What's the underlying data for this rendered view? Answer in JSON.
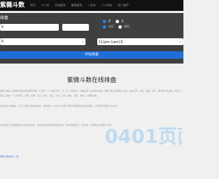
{
  "header": {
    "brand": "紫薇斗数",
    "nav": [
      "首页",
      "十二宫",
      "天府星系",
      "紫薇星系",
      "八卦系",
      "六十四卦",
      "奇门遁甲"
    ]
  },
  "form": {
    "title": "排盘",
    "birth_value": "0",
    "gender_options": [
      "男",
      "女"
    ],
    "calendar_options": [
      "公历",
      "农历"
    ],
    "select_left_value": "0",
    "select_right_value": "11(pm-1am)子",
    "submit_label": "开始排盘"
  },
  "content": {
    "title": "紫微斗数在线排盘",
    "p1": "紫微斗数是一种源自中国古代的算命术数，它通过一个人的出生年、月、日、时等信息，来推演其一生的命运走向。紫微斗数以紫微星为主星，结合天府、太阳、武曲、天同、廉贞等十四主星，形成十二宫位，描述一个人的命宫、兄弟、夫妻、子女、财帛、疾厄、迁移、交友、事业、田宅、福德、父母等方面。",
    "p2": "通过紫微斗数排盘，可以了解自己的性格特点、运势起伏，以及在人生各个阶段可能遇到的机遇与挑战，从而更好地规划人生方向。",
    "p3": "在线排盘工具会根据您输入的出生信息，自动计算命盘中各星曜的位置，并生成完整的十二宫命盘，方便您进行查看与分析。",
    "link": "紫微斗数命盘十二宫"
  },
  "watermark": {
    "text": "0401页面",
    "sub": ""
  }
}
